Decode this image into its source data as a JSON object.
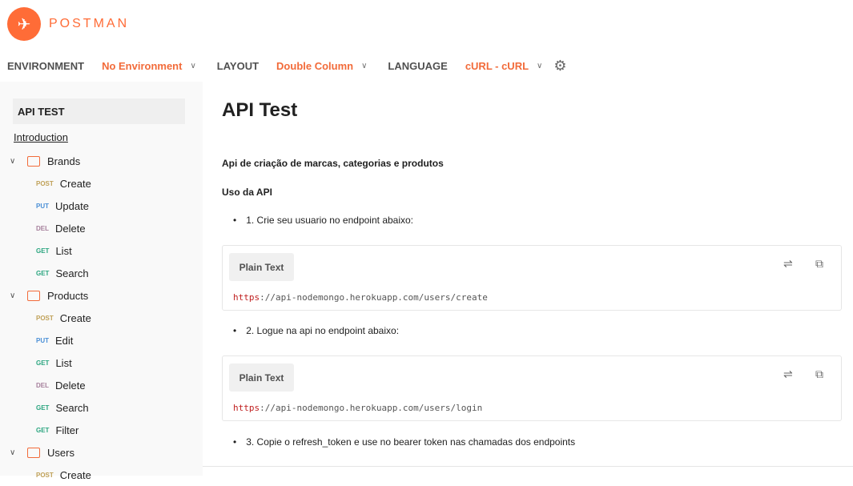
{
  "brand": {
    "name": "POSTMAN",
    "color": "#ff6c37"
  },
  "toolbar": {
    "env_label": "ENVIRONMENT",
    "env_value": "No Environment",
    "layout_label": "LAYOUT",
    "layout_value": "Double Column",
    "lang_label": "LANGUAGE",
    "lang_value": "cURL - cURL"
  },
  "sidebar": {
    "title": "API TEST",
    "intro": "Introduction",
    "folders": [
      {
        "name": "Brands",
        "items": [
          {
            "m": "POST",
            "n": "Create"
          },
          {
            "m": "PUT",
            "n": "Update"
          },
          {
            "m": "DEL",
            "n": "Delete"
          },
          {
            "m": "GET",
            "n": "List"
          },
          {
            "m": "GET",
            "n": "Search"
          }
        ]
      },
      {
        "name": "Products",
        "items": [
          {
            "m": "POST",
            "n": "Create"
          },
          {
            "m": "PUT",
            "n": "Edit"
          },
          {
            "m": "GET",
            "n": "List"
          },
          {
            "m": "DEL",
            "n": "Delete"
          },
          {
            "m": "GET",
            "n": "Search"
          },
          {
            "m": "GET",
            "n": "Filter"
          }
        ]
      },
      {
        "name": "Users",
        "items": [
          {
            "m": "POST",
            "n": "Create"
          }
        ]
      }
    ]
  },
  "main": {
    "title": "API Test",
    "description": "Api de criação de marcas, categorias e produtos",
    "section": "Uso da API",
    "step1": "1. Crie seu usuario no endpoint abaixo:",
    "code1": {
      "lang": "Plain Text",
      "scheme": "https",
      "rest": "://api-nodemongo.herokuapp.com/users/create"
    },
    "step2": "2. Logue na api no endpoint abaixo:",
    "code2": {
      "lang": "Plain Text",
      "scheme": "https",
      "rest": "://api-nodemongo.herokuapp.com/users/login"
    },
    "step3": "3. Copie o refresh_token e use no bearer token nas chamadas dos endpoints"
  }
}
